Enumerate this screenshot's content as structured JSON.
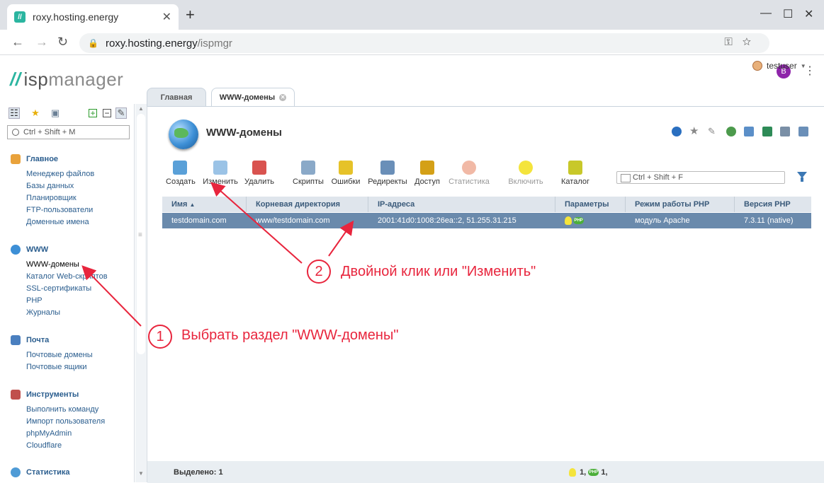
{
  "browser": {
    "tab_title": "roxy.hosting.energy",
    "url_host": "roxy.hosting.energy",
    "url_path": "/ispmgr",
    "profile_initial": "B"
  },
  "app": {
    "logo_prefix": "isp",
    "logo_suffix": "manager",
    "user": "testuser",
    "tabs": [
      {
        "label": "Главная"
      },
      {
        "label": "WWW-домены"
      }
    ]
  },
  "sidebar": {
    "search_placeholder": "Ctrl + Shift + M",
    "groups": [
      {
        "title": "Главное",
        "color": "#e9a23b",
        "items": [
          "Менеджер файлов",
          "Базы данных",
          "Планировщик",
          "FTP-пользователи",
          "Доменные имена"
        ]
      },
      {
        "title": "WWW",
        "color": "#3d8fd6",
        "items": [
          "WWW-домены",
          "Каталог Web-скриптов",
          "SSL-сертификаты",
          "PHP",
          "Журналы"
        ]
      },
      {
        "title": "Почта",
        "color": "#4a7fbf",
        "items": [
          "Почтовые домены",
          "Почтовые ящики"
        ]
      },
      {
        "title": "Инструменты",
        "color": "#c0504d",
        "items": [
          "Выполнить команду",
          "Импорт пользователя",
          "phpMyAdmin",
          "Cloudflare"
        ]
      },
      {
        "title": "Статистика",
        "color": "#4f9bd6",
        "items": []
      }
    ]
  },
  "main": {
    "title": "WWW-домены",
    "toolbar": [
      {
        "label": "Создать",
        "color": "#5aa0d8",
        "disabled": false
      },
      {
        "label": "Изменить",
        "color": "#9bc3e6",
        "disabled": false
      },
      {
        "label": "Удалить",
        "color": "#d9534f",
        "disabled": false
      },
      {
        "label": "Скрипты",
        "color": "#8aa9c8",
        "disabled": false
      },
      {
        "label": "Ошибки",
        "color": "#e6c229",
        "disabled": false
      },
      {
        "label": "Редиректы",
        "color": "#6a8fb8",
        "disabled": false
      },
      {
        "label": "Доступ",
        "color": "#d4a017",
        "disabled": false
      },
      {
        "label": "Статистика",
        "color": "#e88a6a",
        "disabled": true
      },
      {
        "label": "Включить",
        "color": "#f4e43c",
        "disabled": true
      },
      {
        "label": "Каталог",
        "color": "#c8c82a",
        "disabled": false
      }
    ],
    "search_placeholder": "Ctrl + Shift + F",
    "columns": [
      "Имя",
      "Корневая директория",
      "IP-адреса",
      "Параметры",
      "Режим работы PHP",
      "Версия PHP"
    ],
    "rows": [
      {
        "name": "testdomain.com",
        "root": "www/testdomain.com",
        "ip": "2001:41d0:1008:26ea::2, 51.255.31.215",
        "php_badge": "PHP",
        "php_mode": "модуль Apache",
        "php_version": "7.3.11 (native)"
      }
    ],
    "status_left": "Выделено: 1",
    "status_right_a": "1,",
    "status_right_b": "1,"
  },
  "annotations": {
    "step1_num": "1",
    "step1_text": "Выбрать раздел \"WWW-домены\"",
    "step2_num": "2",
    "step2_text": "Двойной клик или \"Изменить\""
  }
}
